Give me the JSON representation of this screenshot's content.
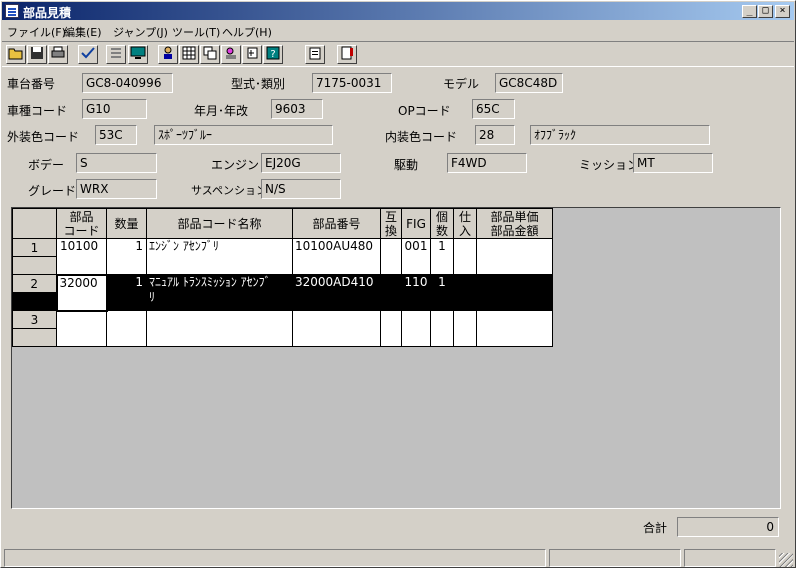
{
  "window": {
    "title": "部品見積",
    "minimize": "_",
    "maximize": "□",
    "close": "×"
  },
  "menu": [
    {
      "label": "ファイル(F)"
    },
    {
      "label": "編集(E)"
    },
    {
      "label": "ジャンプ(J)"
    },
    {
      "label": "ツール(T)"
    },
    {
      "label": "ヘルプ(H)"
    }
  ],
  "toolbar": {
    "icons": [
      "folder-open-icon",
      "save-icon",
      "print-icon",
      "spellcheck-icon",
      "number-list-icon",
      "monitor-icon",
      "user-icon",
      "grid-icon",
      "copy-window-icon",
      "person-search-icon",
      "text-cursor-icon",
      "help-icon",
      "clipboard-icon",
      "report-icon"
    ]
  },
  "vehicle": {
    "chassis_label": "車台番号",
    "chassis_value": "GC8-040996",
    "model_class_label": "型式･類別",
    "model_class_value": "7175-0031",
    "model_label": "モデル",
    "model_value": "GC8C48D",
    "type_code_label": "車種コード",
    "type_code_value": "G10",
    "year_label": "年月･年改",
    "year_value": "9603",
    "op_code_label": "OPコード",
    "op_code_value": "65C",
    "ext_color_label": "外装色コード",
    "ext_color_code": "53C",
    "ext_color_name": "ｽﾎﾟｰﾂﾌﾞﾙｰ",
    "int_color_label": "内装色コード",
    "int_color_code": "28",
    "int_color_name": "ｵﾌﾌﾞﾗｯｸ",
    "body_label": "ボデー",
    "body_value": "S",
    "engine_label": "エンジン",
    "engine_value": "EJ20G",
    "drive_label": "駆動",
    "drive_value": "F4WD",
    "mission_label": "ミッション",
    "mission_value": "MT",
    "grade_label": "グレード",
    "grade_value": "WRX",
    "suspension_label": "サスペンション",
    "suspension_value": "N/S"
  },
  "grid": {
    "headers": {
      "part_code_1": "部品",
      "part_code_2": "コード",
      "qty": "数量",
      "name": "部品コード名称",
      "number": "部品番号",
      "interchange_1": "互",
      "interchange_2": "換",
      "fig": "FIG",
      "count_1": "個",
      "count_2": "数",
      "supply_1": "仕",
      "supply_2": "入",
      "price_1": "部品単価",
      "price_2": "部品金額"
    },
    "rows": [
      {
        "no": "1",
        "code": "10100",
        "qty": "1",
        "name": "ｴﾝｼﾞﾝ ｱｾﾝﾌﾞﾘ",
        "name2": "",
        "number": "10100AU480",
        "interchange": "",
        "fig": "001",
        "count": "1",
        "supply": "",
        "price": ""
      },
      {
        "no": "2",
        "code": "32000",
        "qty": "1",
        "name": "ﾏﾆｭｱﾙ ﾄﾗﾝｽﾐｯｼｮﾝ ｱｾﾝﾌﾞ",
        "name2": "ﾘ",
        "number": "32000AD410",
        "interchange": "",
        "fig": "110",
        "count": "1",
        "supply": "",
        "price": ""
      },
      {
        "no": "3",
        "code": "",
        "qty": "",
        "name": "",
        "name2": "",
        "number": "",
        "interchange": "",
        "fig": "",
        "count": "",
        "supply": "",
        "price": ""
      }
    ]
  },
  "total": {
    "label": "合計",
    "value": "0"
  }
}
